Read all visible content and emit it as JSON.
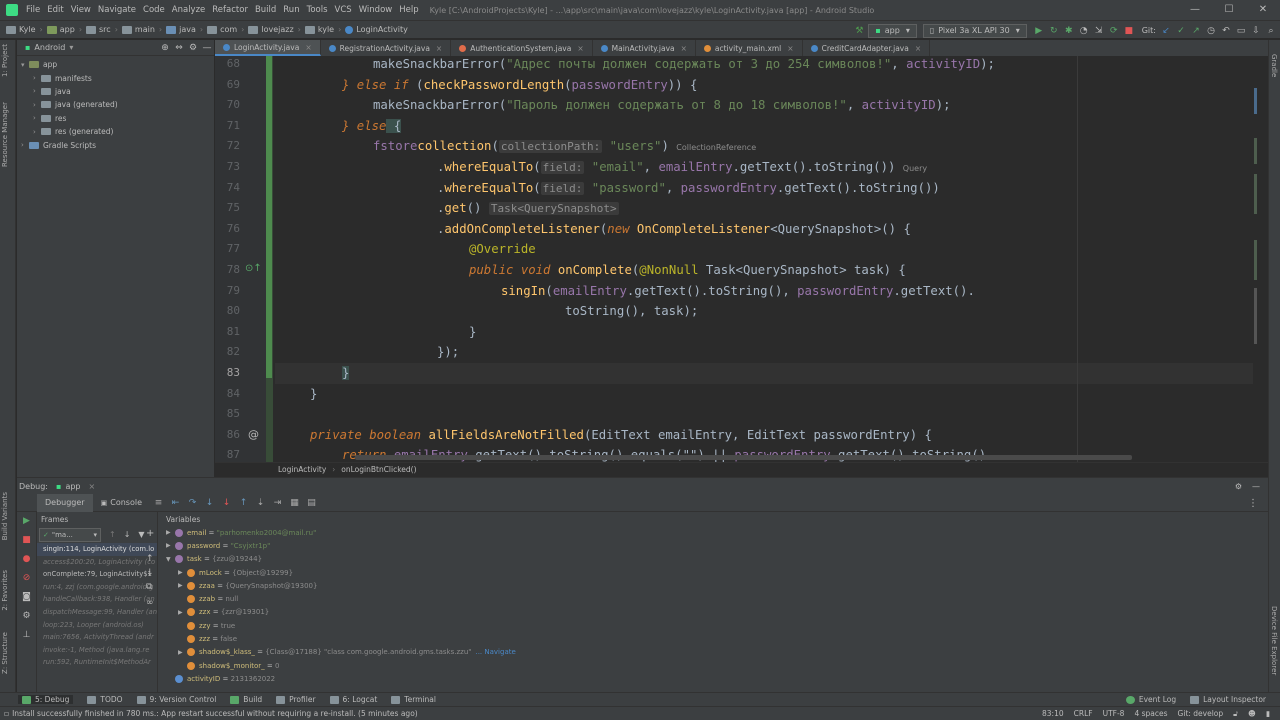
{
  "menu": {
    "items": [
      "File",
      "Edit",
      "View",
      "Navigate",
      "Code",
      "Analyze",
      "Refactor",
      "Build",
      "Run",
      "Tools",
      "VCS",
      "Window",
      "Help"
    ],
    "window_title": "Kyle [C:\\AndroidProjects\\Kyle] - ...\\app\\src\\main\\java\\com\\lovejazz\\kyle\\LoginActivity.java [app] - Android Studio"
  },
  "navbar": {
    "breadcrumbs": [
      "Kyle",
      "app",
      "src",
      "main",
      "java",
      "com",
      "lovejazz",
      "kyle",
      "LoginActivity"
    ],
    "run_config": "app",
    "device": "Pixel 3a XL API 30",
    "git_label": "Git:"
  },
  "left_strip": {
    "project": "1: Project",
    "resource_manager": "Resource Manager",
    "build_variants": "Build Variants",
    "favorites": "2: Favorites",
    "structure": "Z: Structure"
  },
  "right_strip": {
    "gradle": "Gradle",
    "device_file_explorer": "Device File Explorer"
  },
  "project_panel": {
    "view": "Android",
    "tree": [
      {
        "label": "app",
        "indent": 0,
        "expanded": true,
        "kind": "module"
      },
      {
        "label": "manifests",
        "indent": 1,
        "expanded": false,
        "kind": "folder"
      },
      {
        "label": "java",
        "indent": 1,
        "expanded": false,
        "kind": "folder"
      },
      {
        "label": "java (generated)",
        "indent": 1,
        "expanded": false,
        "kind": "folder"
      },
      {
        "label": "res",
        "indent": 1,
        "expanded": false,
        "kind": "folder"
      },
      {
        "label": "res (generated)",
        "indent": 1,
        "expanded": false,
        "kind": "folder"
      },
      {
        "label": "Gradle Scripts",
        "indent": 0,
        "expanded": false,
        "kind": "gradle"
      }
    ]
  },
  "tabs": [
    {
      "label": "LoginActivity.java",
      "active": true,
      "color": "#4a88c7"
    },
    {
      "label": "RegistrationActivity.java",
      "active": false,
      "color": "#4a88c7"
    },
    {
      "label": "AuthenticationSystem.java",
      "active": false,
      "color": "#e06c4a"
    },
    {
      "label": "MainActivity.java",
      "active": false,
      "color": "#4a88c7"
    },
    {
      "label": "activity_main.xml",
      "active": false,
      "color": "#e08e3a"
    },
    {
      "label": "CreditCardAdapter.java",
      "active": false,
      "color": "#4a88c7"
    }
  ],
  "editor": {
    "line_numbers": [
      "68",
      "69",
      "70",
      "71",
      "72",
      "73",
      "74",
      "75",
      "76",
      "77",
      "78",
      "79",
      "80",
      "81",
      "82",
      "83",
      "84",
      "85",
      "86",
      "87"
    ],
    "breadcrumb": [
      "LoginActivity",
      "onLoginBtnClicked()"
    ]
  },
  "code": {
    "l68": {
      "a": "makeSnackbarError(",
      "b": "\"Адрес почты должен содержать от 3 до 254 символов!\"",
      ", ": ", ",
      "c": "activityID",
      ");": ");"
    },
    "l69": {
      "kw1": "} else if",
      "p1": " (",
      "fn": "checkPasswordLength",
      "p2": "(",
      "v": "passwordEntry",
      "p3": ")) {"
    },
    "l70": {
      "a": "makeSnackbarError(",
      "b": "\"Пароль должен содержать от 8 до 18 символов!\"",
      "c": ", ",
      "d": "activityID",
      "e": ");"
    },
    "l71": {
      "kw": "} else",
      "br": " {"
    },
    "l72": {
      "v": "fstore",
      ".": ".",
      "fn": "collection",
      "p": "(",
      "hint": "collectionPath:",
      "s": " \"users\"",
      "e": ")",
      "inl": "CollectionReference"
    },
    "l73": {
      "dot": ".",
      "fn": "whereEqualTo",
      "p": "(",
      "hint": "field:",
      "s": " \"email\"",
      "c": ", ",
      "v": "emailEntry",
      "m": ".getText().toString())",
      "inl": "Query"
    },
    "l74": {
      "dot": ".",
      "fn": "whereEqualTo",
      "p": "(",
      "hint": "field:",
      "s": " \"password\"",
      "c": ", ",
      "v": "passwordEntry",
      "m": ".getText().toString())"
    },
    "l75": {
      "dot": ".",
      "fn": "get",
      "p": "()",
      "hint": "Task<QuerySnapshot>"
    },
    "l76": {
      "dot": ".",
      "fn": "addOnCompleteListener",
      "p": "(",
      "kw": "new",
      "sp": " ",
      "fn2": "OnCompleteListener",
      "g": "<QuerySnapshot>() {"
    },
    "l77": {
      "an": "@Override"
    },
    "l78": {
      "kw": "public void",
      "sp": " ",
      "fn": "onComplete",
      "p": "(",
      "an": "@NonNull",
      "rest": " Task<QuerySnapshot> task) {"
    },
    "l79": {
      "fn": "singIn",
      "p": "(",
      "v": "emailEntry",
      "m": ".getText().toString(), ",
      "v2": "passwordEntry",
      "m2": ".getText()."
    },
    "l80": {
      "m": "toString(), task);"
    },
    "l81": {
      "t": "}"
    },
    "l82": {
      "t": "});"
    },
    "l83": {
      "t": "}"
    },
    "l84": {
      "t": "}"
    },
    "l86": {
      "kw": "private boolean",
      "sp": " ",
      "fn": "allFieldsAreNotFilled",
      "rest": "(EditText emailEntry, EditText passwordEntry) {"
    },
    "l87": {
      "kw": "return",
      "sp": " ",
      "v": "emailEntry",
      "m": ".getText().toString().equals(\"\") || ",
      "v2": "passwordEntry",
      "m2": ".getText().toString()"
    }
  },
  "debug": {
    "label": "Debug:",
    "config": "app",
    "tab_debugger": "Debugger",
    "tab_console": "Console",
    "frames_label": "Frames",
    "variables_label": "Variables",
    "thread_select": "\"ma...",
    "frames": [
      {
        "text": "singIn:114, LoginActivity (com.lo",
        "sel": true,
        "dim": false
      },
      {
        "text": "access$200:20, LoginActivity (co",
        "sel": false,
        "dim": true
      },
      {
        "text": "onComplete:79, LoginActivity$1",
        "sel": false,
        "dim": false
      },
      {
        "text": "run:4, zzj (com.google.android.g",
        "sel": false,
        "dim": true
      },
      {
        "text": "handleCallback:938, Handler (an",
        "sel": false,
        "dim": true
      },
      {
        "text": "dispatchMessage:99, Handler (an",
        "sel": false,
        "dim": true
      },
      {
        "text": "loop:223, Looper (android.os)",
        "sel": false,
        "dim": true
      },
      {
        "text": "main:7656, ActivityThread (andr",
        "sel": false,
        "dim": true
      },
      {
        "text": "invoke:-1, Method (java.lang.re",
        "sel": false,
        "dim": true
      },
      {
        "text": "run:592, RuntimeInit$MethodAr",
        "sel": false,
        "dim": true
      }
    ],
    "variables": [
      {
        "indent": 0,
        "arrow": "▶",
        "icon": "p",
        "name": "email",
        "eq": " = ",
        "val": "\"parhomenko2004@mail.ru\"",
        "vc": "vs",
        "extra": ""
      },
      {
        "indent": 0,
        "arrow": "▶",
        "icon": "p",
        "name": "password",
        "eq": " = ",
        "val": "\"Csyjxtr1p\"",
        "vc": "vs",
        "extra": ""
      },
      {
        "indent": 0,
        "arrow": "▼",
        "icon": "p",
        "name": "task",
        "eq": " = ",
        "val": "{zzu@19244}",
        "vc": "vg",
        "extra": ""
      },
      {
        "indent": 1,
        "arrow": "▶",
        "icon": "o",
        "name": "mLock",
        "eq": " = ",
        "val": "{Object@19299}",
        "vc": "vg",
        "extra": ""
      },
      {
        "indent": 1,
        "arrow": "▶",
        "icon": "o",
        "name": "zzaa",
        "eq": " = ",
        "val": "{QuerySnapshot@19300}",
        "vc": "vg",
        "extra": ""
      },
      {
        "indent": 1,
        "arrow": "",
        "icon": "o",
        "name": "zzab",
        "eq": " = ",
        "val": "null",
        "vc": "vg",
        "extra": ""
      },
      {
        "indent": 1,
        "arrow": "▶",
        "icon": "o",
        "name": "zzx",
        "eq": " = ",
        "val": "{zzr@19301}",
        "vc": "vg",
        "extra": ""
      },
      {
        "indent": 1,
        "arrow": "",
        "icon": "o",
        "name": "zzy",
        "eq": " = ",
        "val": "true",
        "vc": "vg",
        "extra": ""
      },
      {
        "indent": 1,
        "arrow": "",
        "icon": "o",
        "name": "zzz",
        "eq": " = ",
        "val": "false",
        "vc": "vg",
        "extra": ""
      },
      {
        "indent": 1,
        "arrow": "▶",
        "icon": "o",
        "name": "shadow$_klass_",
        "eq": " = ",
        "val": "{Class@17188} \"class com.google.android.gms.tasks.zzu\"",
        "vc": "vg",
        "extra": "... Navigate"
      },
      {
        "indent": 1,
        "arrow": "",
        "icon": "o",
        "name": "shadow$_monitor_",
        "eq": " = ",
        "val": "0",
        "vc": "vg",
        "extra": ""
      },
      {
        "indent": 0,
        "arrow": "",
        "icon": "b",
        "name": "activityID",
        "eq": " = ",
        "val": "2131362022",
        "vc": "vg",
        "extra": ""
      }
    ]
  },
  "bottom_tools": [
    "5: Debug",
    "TODO",
    "9: Version Control",
    "Build",
    "Profiler",
    "6: Logcat",
    "Terminal"
  ],
  "bottom_right_tools": [
    "Event Log",
    "Layout Inspector"
  ],
  "status": {
    "message": "Install successfully finished in 780 ms.: App restart successful without requiring a re-install. (5 minutes ago)",
    "position": "83:10",
    "line_sep": "CRLF",
    "encoding": "UTF-8",
    "indent": "4 spaces",
    "branch": "Git: develop"
  }
}
